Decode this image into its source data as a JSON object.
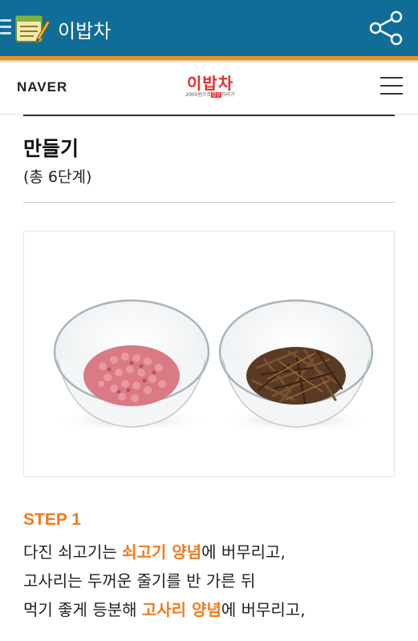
{
  "app": {
    "title": "이밥차",
    "header_color": "#0f6d97",
    "accent_stripe_color": "#e9912e",
    "icons": {
      "menu": "menu-icon",
      "logo": "notepad-logo-icon",
      "share": "share-icon"
    }
  },
  "navbar": {
    "naver_label": "NAVER",
    "brand_main": "이밥차",
    "brand_sub_pre": "2000원으로",
    "brand_sub_hl": "밥상",
    "brand_sub_post": "차리기",
    "brand_color": "#e0312a",
    "icons": {
      "menu": "hamburger-menu-icon"
    }
  },
  "section": {
    "title": "만들기",
    "subtitle": "(총 6단계)"
  },
  "step": {
    "label": "STEP 1",
    "accent_color": "#f07a1d",
    "line1": {
      "pre": "다진 쇠고기는 ",
      "hl": "쇠고기 양념",
      "post": "에 버무리고,"
    },
    "line2": {
      "text": "고사리는 두꺼운 줄기를 반 가른 뒤"
    },
    "line3": {
      "pre": "먹기 좋게 등분해 ",
      "hl": "고사리 양념",
      "post": "에 버무리고,"
    }
  }
}
